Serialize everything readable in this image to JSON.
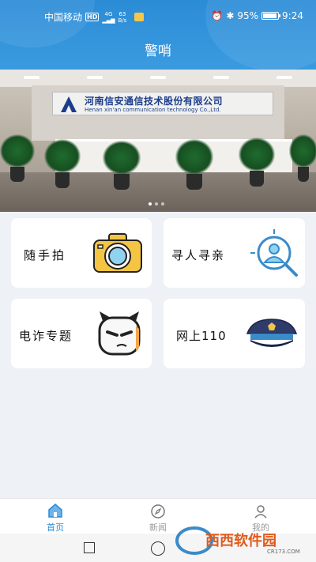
{
  "status_bar": {
    "carrier": "中国移动",
    "hd": "HD",
    "signal": "4G",
    "speed_value": "63",
    "speed_unit": "B/s",
    "battery": "95%",
    "time": "9:24"
  },
  "header": {
    "title": "警哨"
  },
  "banner": {
    "sign_cn": "河南信安通信技术股份有限公司",
    "sign_en": "Henan xin'an communication technology Co.,Ltd.",
    "slides": 3,
    "active_slide": 1
  },
  "cards": [
    {
      "label": "随手拍",
      "icon": "camera-icon"
    },
    {
      "label": "寻人寻亲",
      "icon": "person-search-icon"
    },
    {
      "label": "电诈专题",
      "icon": "devil-face-icon"
    },
    {
      "label": "网上110",
      "icon": "police-cap-icon"
    }
  ],
  "nav": {
    "items": [
      {
        "label": "首页",
        "icon": "home-icon",
        "active": true
      },
      {
        "label": "新闻",
        "icon": "compass-icon",
        "active": false
      },
      {
        "label": "我的",
        "icon": "user-icon",
        "active": false
      }
    ]
  },
  "watermark": {
    "text": "西西软件园",
    "url": "CR173.COM"
  },
  "colors": {
    "primary": "#2b8cd6",
    "nav_active": "#2b8cd6",
    "background": "#eef1f5"
  }
}
